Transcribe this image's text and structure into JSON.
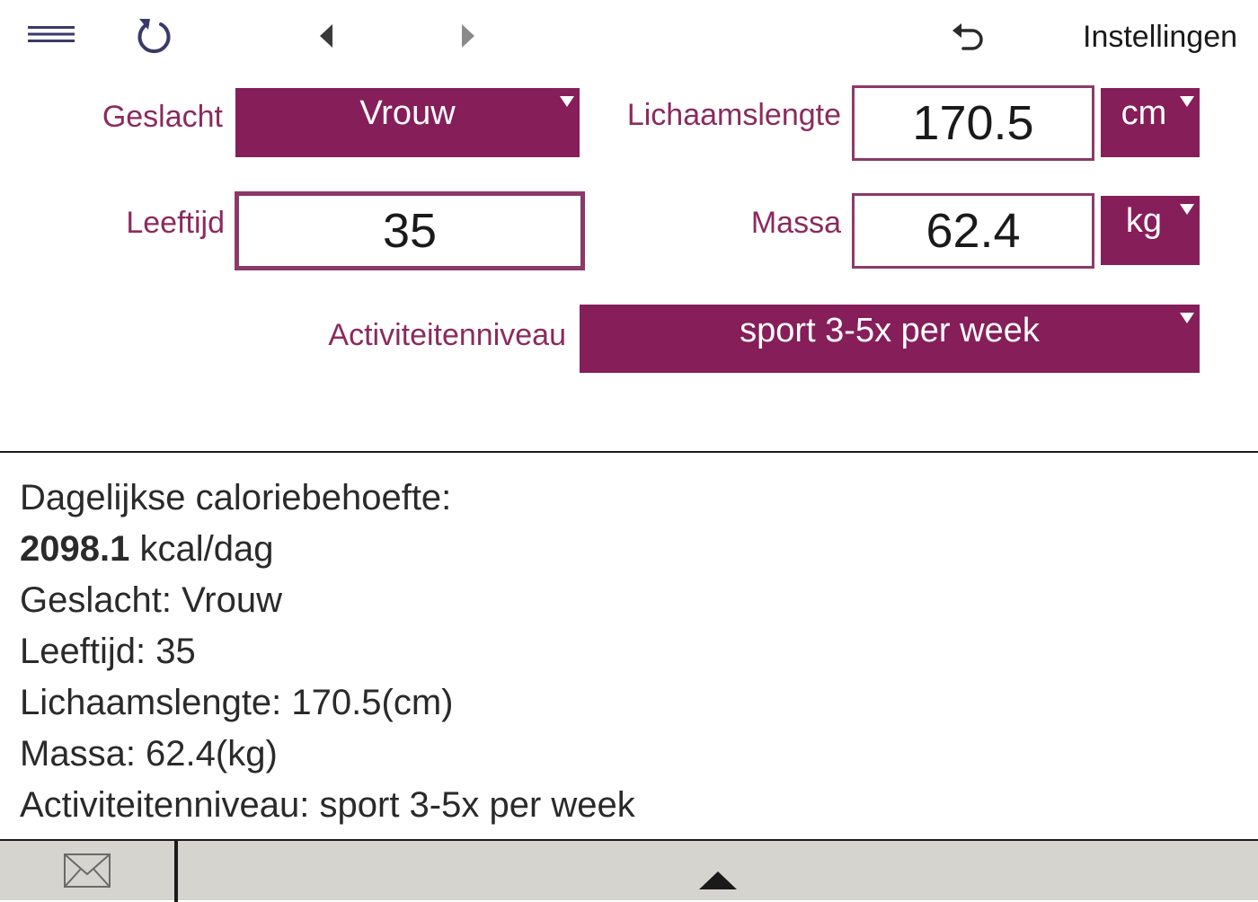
{
  "toolbar": {
    "menu_icon": "hamburger-menu-icon",
    "reset_icon": "reload-icon",
    "prev_icon": "triangle-left-icon",
    "next_icon": "triangle-right-icon",
    "undo_icon": "undo-arrow-icon",
    "settings_label": "Instellingen"
  },
  "form": {
    "gender": {
      "label": "Geslacht",
      "value": "Vrouw"
    },
    "height": {
      "label": "Lichaamslengte",
      "value": "170.5",
      "unit": "cm"
    },
    "age": {
      "label": "Leeftijd",
      "value": "35"
    },
    "mass": {
      "label": "Massa",
      "value": "62.4",
      "unit": "kg"
    },
    "activity": {
      "label": "Activiteitenniveau",
      "value": "sport 3-5x per week"
    }
  },
  "results": {
    "heading": "Dagelijkse caloriebehoefte:",
    "kcal_value": "2098.1",
    "kcal_unit": " kcal/dag",
    "lines": [
      "Geslacht: Vrouw",
      "Leeftijd: 35",
      "Lichaamslengte: 170.5(cm)",
      "Massa: 62.4(kg)",
      "Activiteitenniveau: sport 3-5x per week"
    ]
  },
  "bottombar": {
    "mail_icon": "envelope-icon",
    "expand_icon": "triangle-up-icon"
  },
  "colors": {
    "accent": "#861e5a",
    "label": "#8b2a5e",
    "input_border": "#8b3a68",
    "bottombar_bg": "#d5d4cf"
  }
}
